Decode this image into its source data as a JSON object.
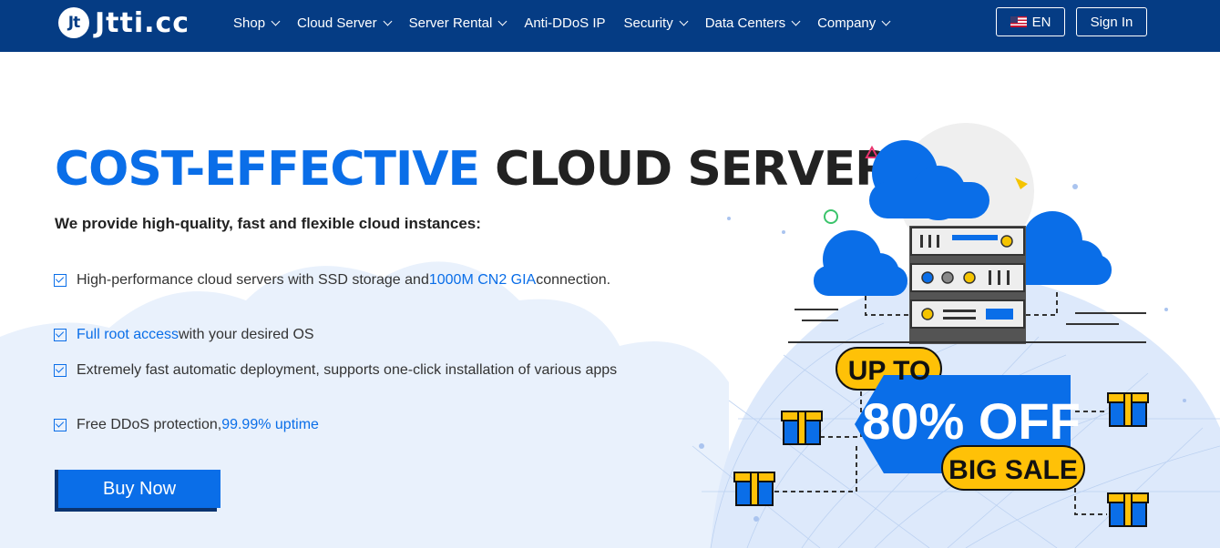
{
  "header": {
    "logo_mark": "Jt",
    "logo_text": "Jtti.cc",
    "menu": [
      {
        "label": "Shop",
        "dropdown": true
      },
      {
        "label": "Cloud Server",
        "dropdown": true
      },
      {
        "label": "Server Rental",
        "dropdown": true
      },
      {
        "label": "Anti-DDoS IP",
        "dropdown": false
      },
      {
        "label": "Security",
        "dropdown": true
      },
      {
        "label": "Data Centers",
        "dropdown": true
      },
      {
        "label": "Company",
        "dropdown": true
      }
    ],
    "language_label": "EN",
    "signin_label": "Sign In"
  },
  "hero": {
    "title_highlight": "COST-EFFECTIVE",
    "title_rest": "CLOUD SERVER",
    "subtitle": "We provide high-quality, fast and flexible cloud instances:",
    "features": [
      {
        "before": "High-performance cloud servers with SSD storage and ",
        "highlight": "1000M CN2 GIA",
        "after": " connection."
      },
      {
        "before": "",
        "highlight": "Full root access",
        "after": " with your desired OS"
      },
      {
        "before": "Extremely fast automatic deployment, supports one-click installation of various apps",
        "highlight": "",
        "after": ""
      },
      {
        "before": "Free DDoS protection, ",
        "highlight": "99.99% uptime",
        "after": ""
      }
    ],
    "buy_label": "Buy Now"
  },
  "promo": {
    "up_to": "UP TO",
    "discount": "80% OFF",
    "big_sale": "BIG SALE"
  },
  "colors": {
    "nav_bg": "#053c84",
    "accent": "#0a6ee8",
    "promo_yellow": "#ffc107",
    "cloud_light": "#e8f0fc"
  }
}
